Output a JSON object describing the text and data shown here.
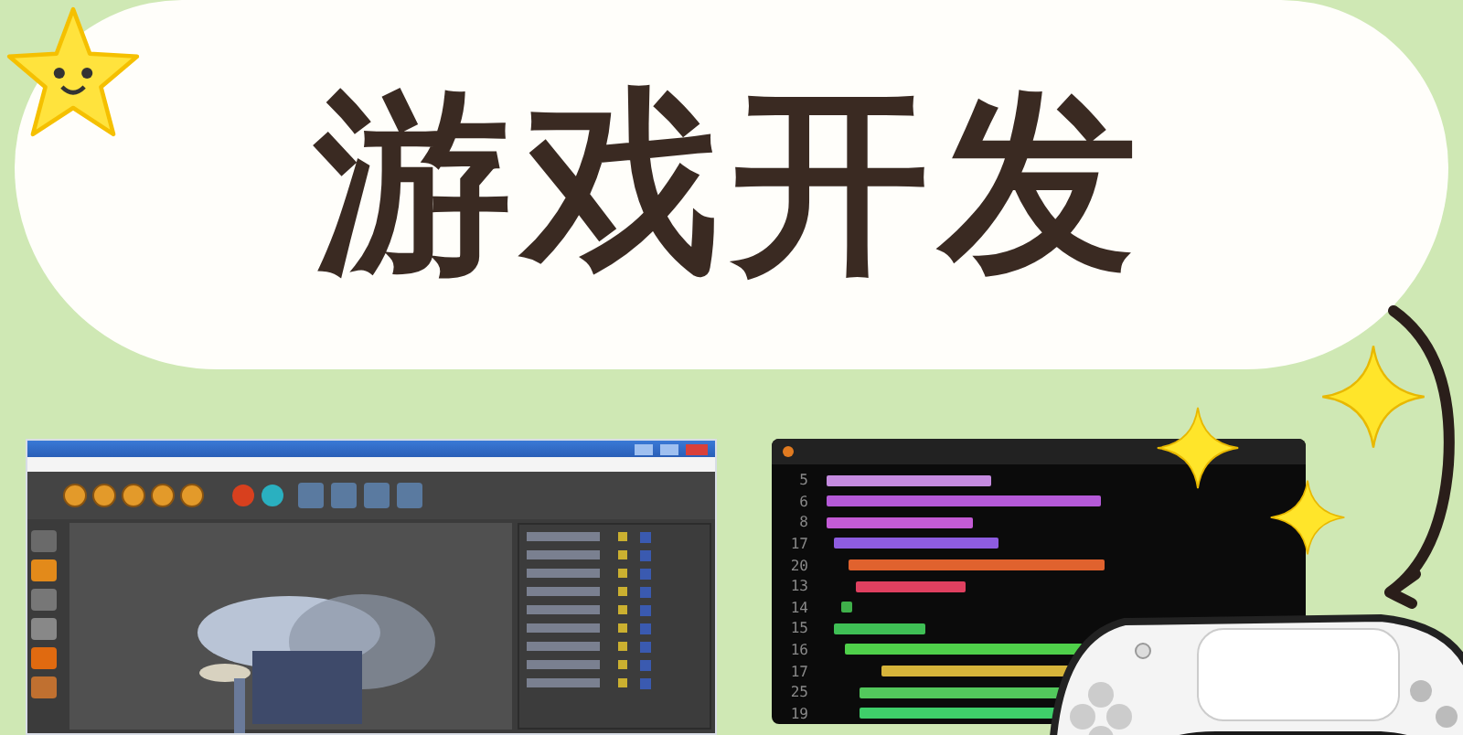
{
  "title": "游戏开发",
  "code_editor": {
    "line_numbers": [
      "5",
      "6",
      "8",
      "17",
      "20",
      "13",
      "14",
      "15",
      "16",
      "17",
      "25",
      "19"
    ]
  }
}
